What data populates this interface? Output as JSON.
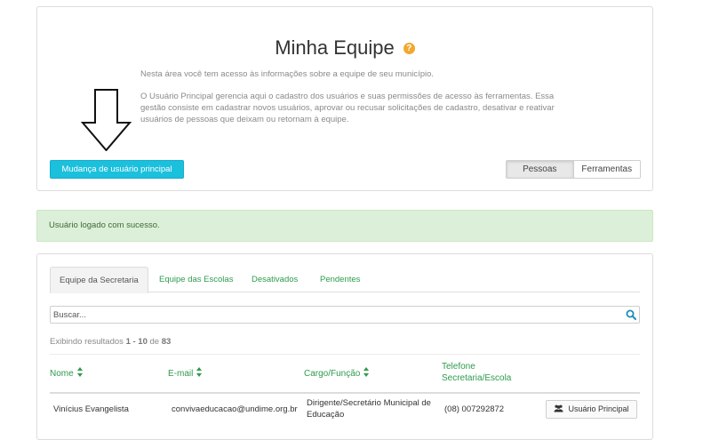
{
  "header": {
    "title": "Minha Equipe",
    "help_icon_glyph": "?",
    "intro_paragraph_1": "Nesta área você tem acesso às informações sobre a equipe de seu município.",
    "intro_paragraph_2": "O Usuário Principal gerencia aqui o cadastro dos usuários e suas permissões de acesso às ferramentas. Essa gestão consiste em cadastrar novos usuários, aprovar ou recusar solicitações de cadastro, desativar e reativar usuários de pessoas que deixam ou retornam à equipe.",
    "change_user_button": "Mudança de usuário principal",
    "view_toggle": [
      "Pessoas",
      "Ferramentas"
    ],
    "view_toggle_active": "Pessoas"
  },
  "alert": {
    "message": "Usuário logado com sucesso."
  },
  "team": {
    "tabs": [
      "Equipe da Secretaria",
      "Equipe das Escolas",
      "Desativados",
      "Pendentes"
    ],
    "active_tab": "Equipe da Secretaria",
    "search_placeholder": "Buscar...",
    "results": {
      "prefix": "Exibindo resultados",
      "range": "1 - 10",
      "connector": "de",
      "total": "83"
    },
    "columns": [
      "Nome",
      "E-mail",
      "Cargo/Função",
      "Telefone Secretaria/Escola"
    ],
    "rows": [
      {
        "nome": "Vinícius Evangelista",
        "email": "convivaeducacao@undime.org.br",
        "cargo": "Dirigente/Secretário Municipal de Educação",
        "telefone": "(08) 007292872",
        "role_button": "Usuário Principal",
        "role_icon": "users-icon"
      }
    ]
  },
  "colors": {
    "accent_button": "#1bc0dd",
    "link_green": "#2e9b4e",
    "alert_bg": "#dcefd8",
    "help_icon": "#f0a830"
  }
}
